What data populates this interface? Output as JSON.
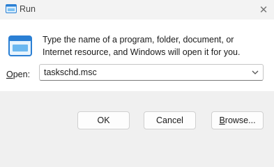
{
  "window": {
    "title": "Run",
    "close_icon": "close-icon"
  },
  "dialog": {
    "description": "Type the name of a program, folder, document, or Internet resource, and Windows will open it for you.",
    "open_label_accel": "O",
    "open_label_rest": "pen:",
    "input_value": "taskschd.msc"
  },
  "buttons": {
    "ok": "OK",
    "cancel": "Cancel",
    "browse_accel": "B",
    "browse_rest": "rowse..."
  },
  "colors": {
    "accent": "#2a7fd4",
    "content_bg": "#ffffff",
    "footer_bg": "#f0f0f0"
  }
}
